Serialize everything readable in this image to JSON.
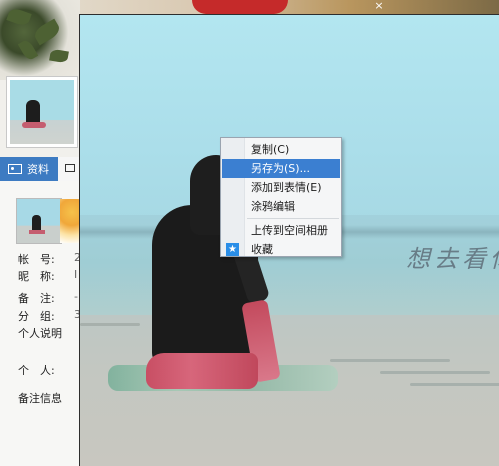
{
  "window": {
    "close_glyph": "×"
  },
  "profile": {
    "tab_label": "资料",
    "fields": [
      {
        "label": "帐　号:",
        "value": "2"
      },
      {
        "label": "昵　称:",
        "value": "I"
      },
      {
        "label": "备　注:",
        "value": "-"
      },
      {
        "label": "分　组:",
        "value": "3"
      },
      {
        "label": "个人说明",
        "value": ""
      },
      {
        "label": "个　人:",
        "value": ""
      },
      {
        "label": "备注信息",
        "value": ""
      }
    ]
  },
  "viewer": {
    "overlay_text": "想去看你"
  },
  "context_menu": {
    "items": [
      {
        "label": "复制(C)",
        "highlighted": false
      },
      {
        "label": "另存为(S)...",
        "highlighted": true
      },
      {
        "label": "添加到表情(E)",
        "highlighted": false
      },
      {
        "label": "涂鸦编辑",
        "highlighted": false
      },
      {
        "label": "上传到空间相册",
        "highlighted": false
      },
      {
        "label": "收藏",
        "highlighted": false,
        "icon": "star-icon"
      }
    ],
    "highlight_color": "#3b7fd1"
  }
}
